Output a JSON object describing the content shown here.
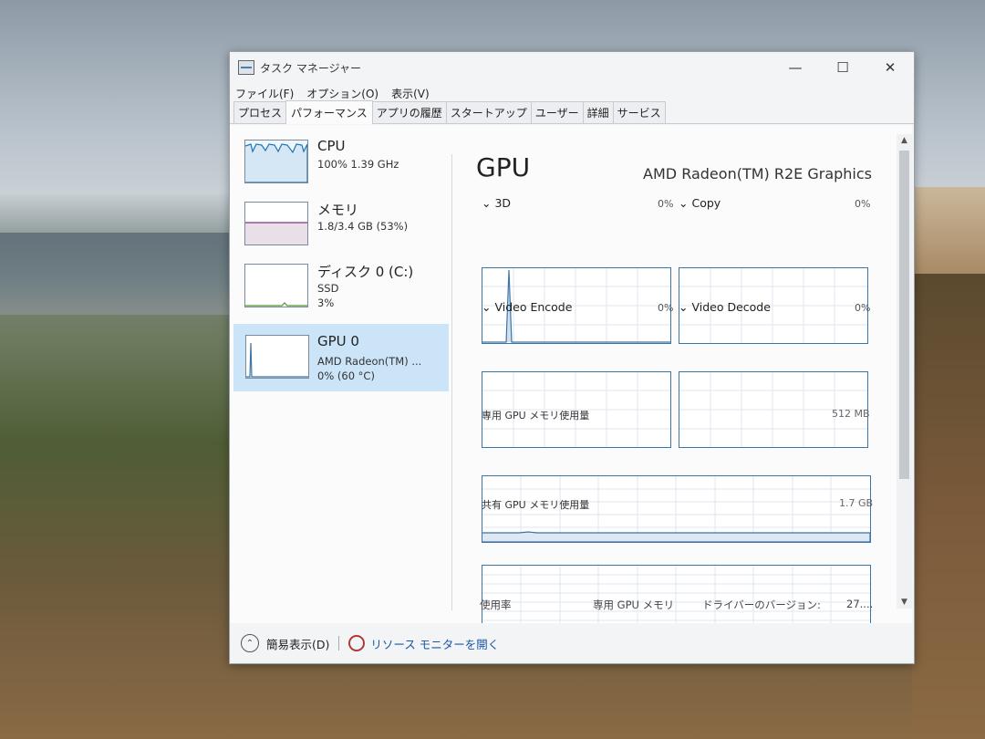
{
  "window": {
    "title": "タスク マネージャー",
    "minimize": "—",
    "maximize": "☐",
    "close": "✕"
  },
  "menu": [
    "ファイル(F)",
    "オプション(O)",
    "表示(V)"
  ],
  "tabs": [
    "プロセス",
    "パフォーマンス",
    "アプリの履歴",
    "スタートアップ",
    "ユーザー",
    "詳細",
    "サービス"
  ],
  "active_tab": "パフォーマンス",
  "sidebar": [
    {
      "title": "CPU",
      "sub1": "100%  1.39 GHz",
      "sub2": ""
    },
    {
      "title": "メモリ",
      "sub1": "1.8/3.4 GB (53%)",
      "sub2": ""
    },
    {
      "title": "ディスク 0 (C:)",
      "sub1": "SSD",
      "sub2": "3%"
    },
    {
      "title": "GPU 0",
      "sub1": "AMD Radeon(TM) ...",
      "sub2": "0%  (60 °C)"
    }
  ],
  "gpu": {
    "title": "GPU",
    "model": "AMD Radeon(TM) R2E Graphics",
    "engines": [
      {
        "name": "3D",
        "pct": "0%"
      },
      {
        "name": "Copy",
        "pct": "0%"
      },
      {
        "name": "Video Encode",
        "pct": "0%"
      },
      {
        "name": "Video Decode",
        "pct": "0%"
      }
    ],
    "dedicated_mem": {
      "label": "専用 GPU メモリ使用量",
      "max": "512 MB"
    },
    "shared_mem": {
      "label": "共有 GPU メモリ使用量",
      "max": "1.7 GB"
    },
    "footer": {
      "utilization": "使用率",
      "dedicated": "専用 GPU メモリ",
      "driver": "ドライバーのバージョン:",
      "driver_value": "27...."
    }
  },
  "bottom": {
    "fewer_details": "簡易表示(D)",
    "resource_monitor": "リソース モニターを開く"
  },
  "colors": {
    "cpu": "#1a73b5",
    "memory": "#8b2f8b",
    "disk": "#4a9a2a",
    "gpu": "#3d74a8",
    "selected": "#cce4f7"
  }
}
